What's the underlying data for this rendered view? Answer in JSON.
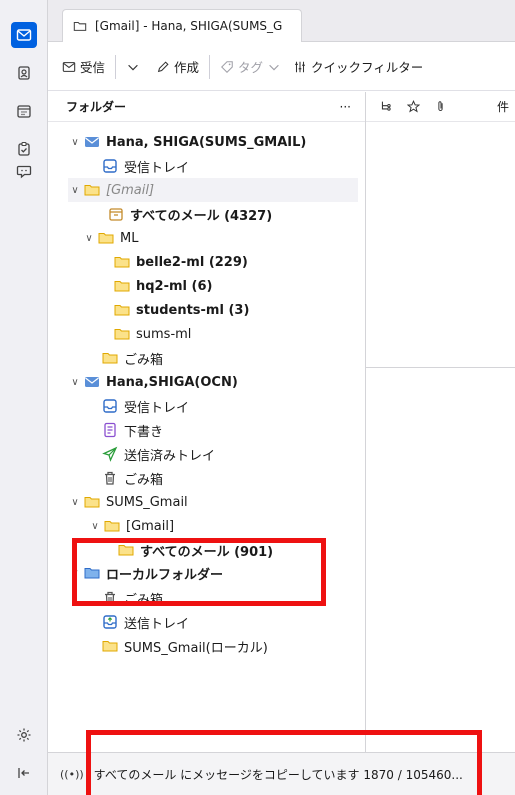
{
  "tab": {
    "title": "[Gmail] - Hana, SHIGA(SUMS_G"
  },
  "toolbar": {
    "receive": "受信",
    "compose": "作成",
    "tag": "タグ",
    "quickfilter": "クイックフィルター"
  },
  "folderpane": {
    "header": "フォルダー",
    "menu": "···"
  },
  "folders": [
    {
      "label": "Hana, SHIGA(SUMS_GMAIL)",
      "bold": true,
      "twisty": "v"
    },
    {
      "label": "受信トレイ"
    },
    {
      "label": "[Gmail]",
      "dim": true,
      "twisty": "v"
    },
    {
      "label": "すべてのメール (4327)",
      "bold": true
    },
    {
      "label": "ML",
      "twisty": "v"
    },
    {
      "label": "belle2-ml (229)",
      "bold": true
    },
    {
      "label": "hq2-ml (6)",
      "bold": true
    },
    {
      "label": "students-ml (3)",
      "bold": true
    },
    {
      "label": "sums-ml"
    },
    {
      "label": "ごみ箱"
    },
    {
      "label": "Hana,SHIGA(OCN)",
      "bold": true,
      "twisty": "v"
    },
    {
      "label": "受信トレイ"
    },
    {
      "label": "下書き"
    },
    {
      "label": "送信済みトレイ"
    },
    {
      "label": "ごみ箱"
    },
    {
      "label": "SUMS_Gmail",
      "twisty": "v"
    },
    {
      "label": "[Gmail]",
      "twisty": "v"
    },
    {
      "label": "すべてのメール (901)",
      "bold": true
    },
    {
      "label": "ローカルフォルダー",
      "bold": true,
      "twisty": "v"
    },
    {
      "label": "ごみ箱"
    },
    {
      "label": "送信トレイ"
    },
    {
      "label": "SUMS_Gmail(ローカル)"
    }
  ],
  "msglist": {
    "subject_col": "件"
  },
  "status": {
    "activity": "((•))",
    "message": "すべてのメール にメッセージをコピーしています 1870 / 105460..."
  },
  "colors": {
    "accent": "#0061e0",
    "highlight": "#ee1111",
    "folder": "#f5b301"
  }
}
